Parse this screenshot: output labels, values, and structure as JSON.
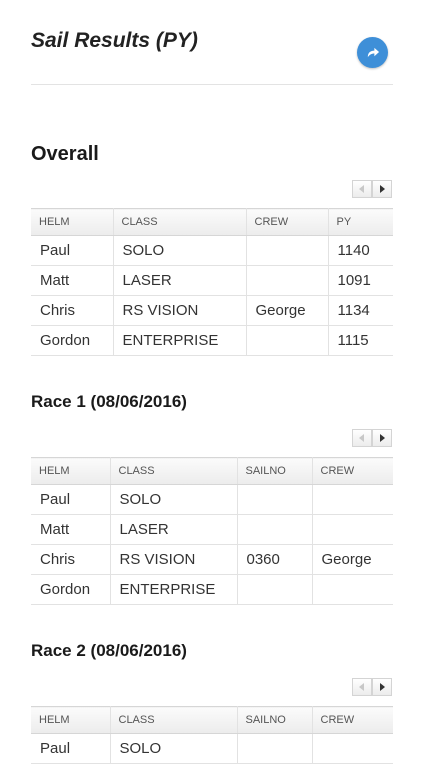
{
  "header": {
    "title": "Sail Results (PY)",
    "share_icon": "share-icon"
  },
  "overall": {
    "title": "Overall",
    "columns": [
      "HELM",
      "CLASS",
      "CREW",
      "PY"
    ],
    "rows": [
      [
        "Paul",
        "SOLO",
        "",
        "1140"
      ],
      [
        "Matt",
        "LASER",
        "",
        "1091"
      ],
      [
        "Chris",
        "RS VISION",
        "George",
        "1134"
      ],
      [
        "Gordon",
        "ENTERPRISE",
        "",
        "1115"
      ]
    ]
  },
  "race1": {
    "title": "Race 1 (08/06/2016)",
    "columns": [
      "HELM",
      "CLASS",
      "SAILNO",
      "CREW"
    ],
    "rows": [
      [
        "Paul",
        "SOLO",
        "",
        ""
      ],
      [
        "Matt",
        "LASER",
        "",
        ""
      ],
      [
        "Chris",
        "RS VISION",
        "0360",
        "George"
      ],
      [
        "Gordon",
        "ENTERPRISE",
        "",
        ""
      ]
    ]
  },
  "race2": {
    "title": "Race 2 (08/06/2016)",
    "columns": [
      "HELM",
      "CLASS",
      "SAILNO",
      "CREW"
    ],
    "rows": [
      [
        "Paul",
        "SOLO",
        "",
        ""
      ]
    ]
  },
  "pager": {
    "prev_icon": "scroll-left-icon",
    "next_icon": "scroll-right-icon"
  },
  "colors": {
    "accent": "#3e8fd8",
    "text": "#333333",
    "header_bg": "#ececec",
    "border": "#e2e2e2"
  }
}
